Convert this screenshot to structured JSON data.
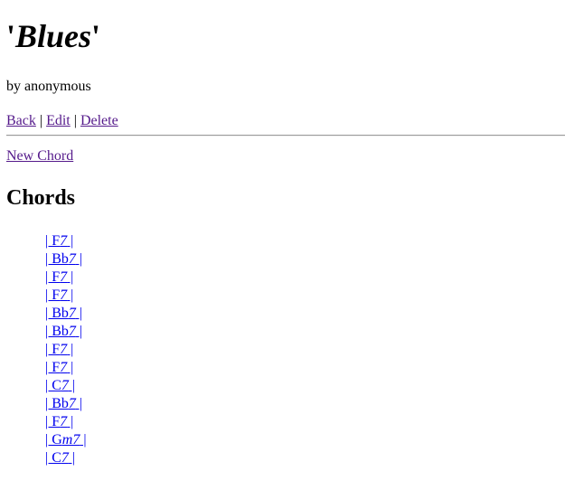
{
  "header": {
    "title_quote_open": "'",
    "title_name": "Blues",
    "title_quote_close": "'",
    "byline": "by anonymous"
  },
  "actions": {
    "back": "Back",
    "edit": "Edit",
    "delete": "Delete",
    "separator": "|"
  },
  "new_chord": "New Chord",
  "section_title": "Chords",
  "chords": [
    {
      "pre": "| F",
      "mid": "7",
      "post": " |"
    },
    {
      "pre": "| Bb",
      "mid": "7",
      "post": " |"
    },
    {
      "pre": "| F",
      "mid": "7",
      "post": " |"
    },
    {
      "pre": "| F",
      "mid": "7",
      "post": " |"
    },
    {
      "pre": "| Bb",
      "mid": "7",
      "post": " |"
    },
    {
      "pre": "| Bb",
      "mid": "7",
      "post": " |"
    },
    {
      "pre": "| F",
      "mid": "7",
      "post": " |"
    },
    {
      "pre": "| F",
      "mid": "7",
      "post": " |"
    },
    {
      "pre": "| C",
      "mid": "7",
      "post": " |"
    },
    {
      "pre": "| Bb",
      "mid": "7",
      "post": " |"
    },
    {
      "pre": "| F",
      "mid": "7",
      "post": " |"
    },
    {
      "pre": "| G",
      "mid": "m7",
      "post": " |"
    },
    {
      "pre": "| C",
      "mid": "7",
      "post": " |"
    }
  ],
  "colors": {
    "visited_link": "#551a8b",
    "link": "#0000ee",
    "divider": "#9a9a9a"
  }
}
